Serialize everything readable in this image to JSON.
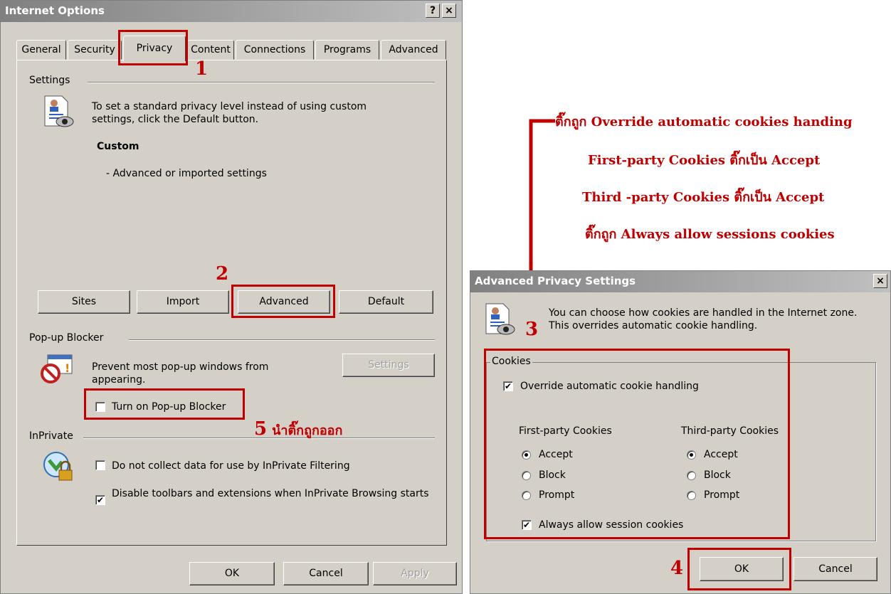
{
  "internet_options": {
    "title": "Internet Options",
    "help_btn": "?",
    "close_btn": "×",
    "tabs": [
      "General",
      "Security",
      "Privacy",
      "Content",
      "Connections",
      "Programs",
      "Advanced"
    ],
    "settings_group": "Settings",
    "settings_desc": "To set a standard privacy level instead of using custom settings, click the Default button.",
    "level_name": "Custom",
    "level_desc": "- Advanced or imported settings",
    "buttons": {
      "sites": "Sites",
      "import": "Import",
      "advanced": "Advanced",
      "default": "Default"
    },
    "popup_group": "Pop-up Blocker",
    "popup_desc": "Prevent most pop-up windows from appearing.",
    "popup_settings": "Settings",
    "popup_checkbox": "Turn on Pop-up Blocker",
    "popup_checked": false,
    "inprivate_group": "InPrivate",
    "inprivate_opt1": "Do not collect data for use by InPrivate Filtering",
    "inprivate_opt1_checked": false,
    "inprivate_opt2": "Disable toolbars and extensions when InPrivate Browsing starts",
    "inprivate_opt2_checked": true,
    "ok": "OK",
    "cancel": "Cancel",
    "apply": "Apply"
  },
  "advanced_privacy": {
    "title": "Advanced Privacy Settings",
    "close_btn": "×",
    "desc": "You can choose how cookies are handled in the Internet zone.  This overrides automatic cookie handling.",
    "cookies_group": "Cookies",
    "override_label": "Override automatic cookie handling",
    "override_checked": true,
    "first_party": "First-party Cookies",
    "third_party": "Third-party Cookies",
    "options": [
      "Accept",
      "Block",
      "Prompt"
    ],
    "first_selected": "Accept",
    "third_selected": "Accept",
    "session_label": "Always allow session cookies",
    "session_checked": true,
    "ok": "OK",
    "cancel": "Cancel"
  },
  "annotations": {
    "step1": "1",
    "step2": "2",
    "step3": "3",
    "step4": "4",
    "step5": "5",
    "step5_text": "นำติ๊กถูกออก",
    "instr1": "ติ๊กถูก Override automatic cookies handing",
    "instr2": "First-party Cookies ติ๊กเป็น Accept",
    "instr3": "Third -party Cookies ติ๊กเป็น Accept",
    "instr4": "ติ๊กถูก Always allow sessions cookies"
  },
  "colors": {
    "annotation_red": "#c00000",
    "dialog_bg": "#d4d0c8"
  }
}
